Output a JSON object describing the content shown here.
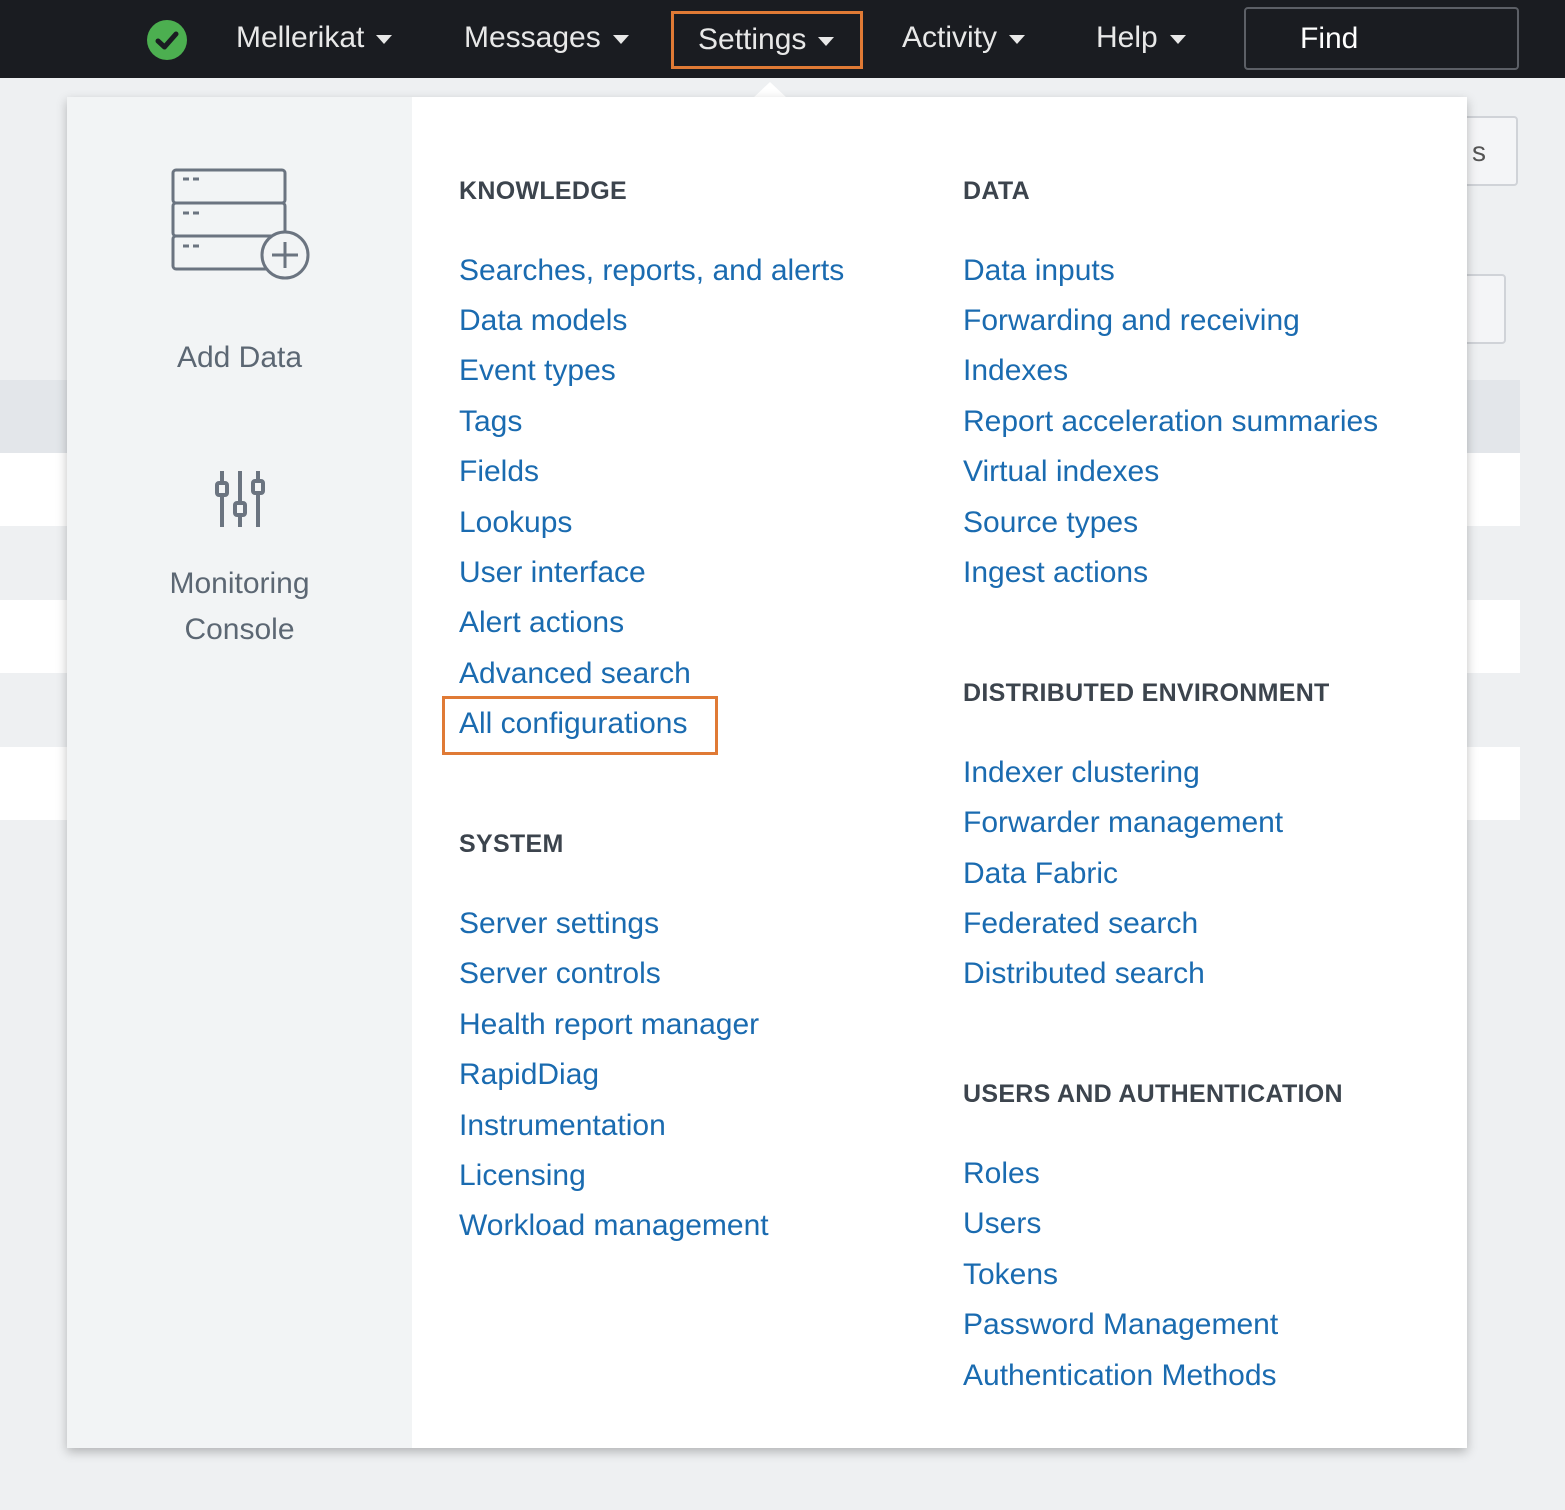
{
  "topbar": {
    "status_icon": "check-circle-icon",
    "status_color": "#4caf50",
    "nav": [
      {
        "label": "Mellerikat"
      },
      {
        "label": "Messages"
      },
      {
        "label": "Settings"
      },
      {
        "label": "Activity"
      },
      {
        "label": "Help"
      }
    ],
    "find_label": "Find",
    "highlight_color": "#e07a35"
  },
  "background": {
    "button_fragment": "s"
  },
  "settings_menu": {
    "quick_links": [
      {
        "label": "Add Data",
        "icon": "add-data-icon"
      },
      {
        "label_line1": "Monitoring",
        "label_line2": "Console",
        "icon": "sliders-icon"
      }
    ],
    "knowledge": {
      "heading": "KNOWLEDGE",
      "items": [
        "Searches, reports, and alerts",
        "Data models",
        "Event types",
        "Tags",
        "Fields",
        "Lookups",
        "User interface",
        "Alert actions",
        "Advanced search",
        "All configurations"
      ]
    },
    "system": {
      "heading": "SYSTEM",
      "items": [
        "Server settings",
        "Server controls",
        "Health report manager",
        "RapidDiag",
        "Instrumentation",
        "Licensing",
        "Workload management"
      ]
    },
    "data": {
      "heading": "DATA",
      "items": [
        "Data inputs",
        "Forwarding and receiving",
        "Indexes",
        "Report acceleration summaries",
        "Virtual indexes",
        "Source types",
        "Ingest actions"
      ]
    },
    "distributed": {
      "heading": "DISTRIBUTED ENVIRONMENT",
      "items": [
        "Indexer clustering",
        "Forwarder management",
        "Data Fabric",
        "Federated search",
        "Distributed search"
      ]
    },
    "users": {
      "heading": "USERS AND AUTHENTICATION",
      "items": [
        "Roles",
        "Users",
        "Tokens",
        "Password Management",
        "Authentication Methods"
      ]
    },
    "link_color": "#1a6bb0"
  }
}
